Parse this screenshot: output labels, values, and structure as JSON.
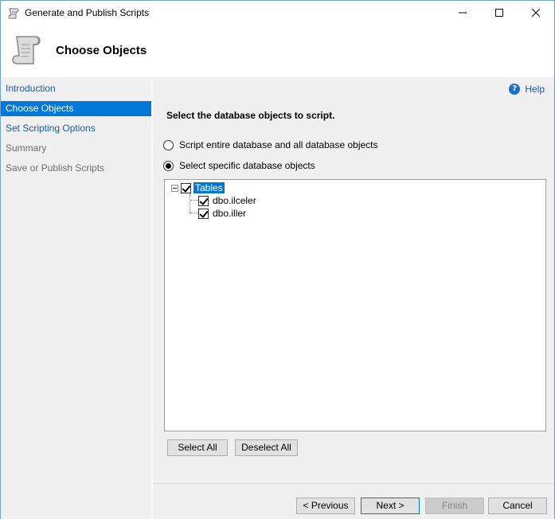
{
  "window": {
    "title": "Generate and Publish Scripts"
  },
  "header": {
    "title": "Choose Objects"
  },
  "nav": {
    "items": [
      {
        "label": "Introduction",
        "state": "link"
      },
      {
        "label": "Choose Objects",
        "state": "selected"
      },
      {
        "label": "Set Scripting Options",
        "state": "link"
      },
      {
        "label": "Summary",
        "state": "disabled"
      },
      {
        "label": "Save or Publish Scripts",
        "state": "disabled"
      }
    ]
  },
  "main": {
    "help_label": "Help",
    "heading": "Select the database objects to script.",
    "options": [
      {
        "label": "Script entire database and all database objects",
        "selected": false
      },
      {
        "label": "Select specific database objects",
        "selected": true
      }
    ],
    "tree": {
      "root": {
        "label": "Tables",
        "checked": true,
        "expanded": true
      },
      "children": [
        {
          "label": "dbo.ilceler",
          "checked": true
        },
        {
          "label": "dbo.iller",
          "checked": true
        }
      ]
    },
    "select_all_label": "Select All",
    "deselect_all_label": "Deselect All"
  },
  "footer": {
    "previous_label": "< Previous",
    "next_label": "Next >",
    "finish_label": "Finish",
    "cancel_label": "Cancel"
  },
  "colors": {
    "accent": "#0078d7",
    "link": "#1e5aa8",
    "panel": "#f0f0f0"
  }
}
